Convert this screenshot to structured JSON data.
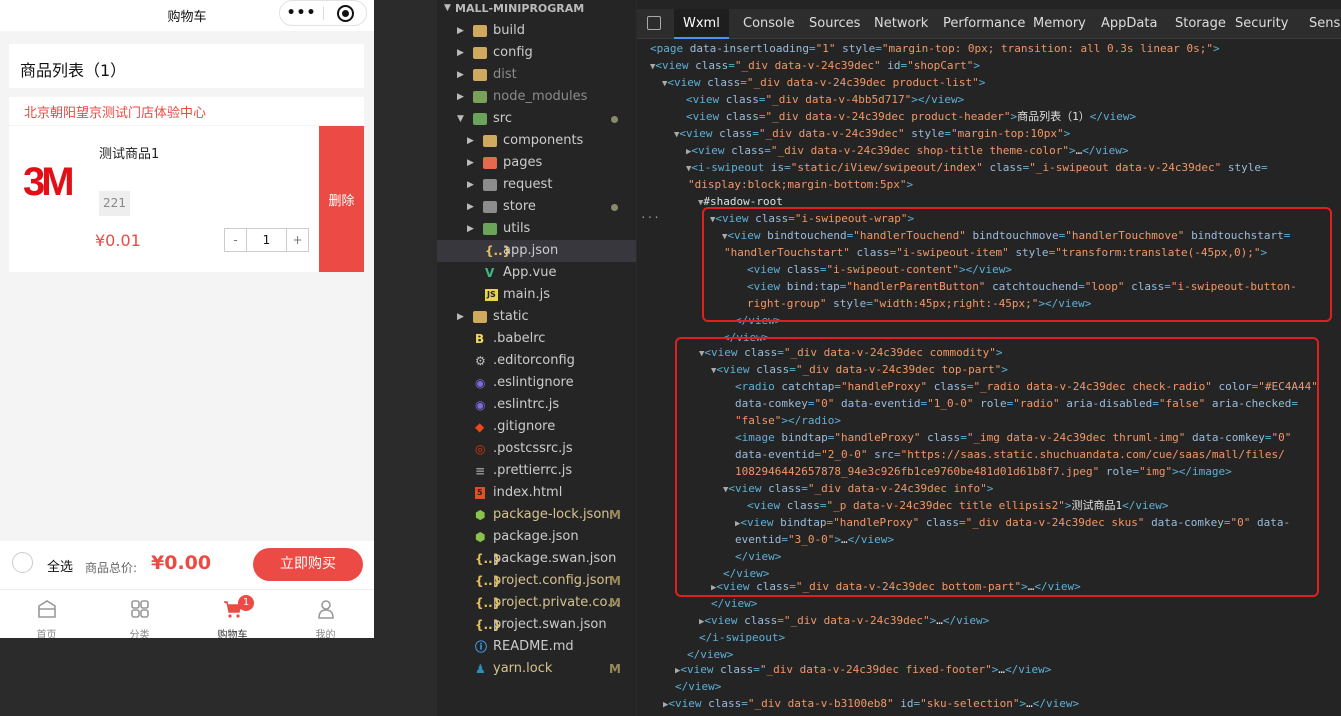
{
  "simulator": {
    "nav_title": "购物车",
    "capsule_dots": "•••",
    "product_header": "商品列表（1）",
    "shop_title": "北京朝阳望京测试门店体验中心",
    "item": {
      "logo": "3M",
      "title": "测试商品1",
      "sku": "221",
      "price": "¥0.01",
      "quantity": "1",
      "minus": "-",
      "plus": "+",
      "delete_label": "删除"
    },
    "footer": {
      "select_all": "全选",
      "total_label": "商品总价:",
      "total_value": "¥0.00",
      "buy_label": "立即购买"
    },
    "tabbar": [
      {
        "label": "首页",
        "icon": "home-icon"
      },
      {
        "label": "分类",
        "icon": "category-icon"
      },
      {
        "label": "购物车",
        "icon": "cart-icon",
        "badge": "1",
        "active": true
      },
      {
        "label": "我的",
        "icon": "user-icon"
      }
    ],
    "accent_color": "#EC4A44"
  },
  "explorer": {
    "root": "MALL-MINIPROGRAM",
    "items": [
      {
        "name": "build",
        "icon": "folder-icon"
      },
      {
        "name": "config",
        "icon": "folder-icon"
      },
      {
        "name": "dist",
        "icon": "folder-icon"
      },
      {
        "name": "node_modules",
        "icon": "folder-icon"
      },
      {
        "name": "src",
        "icon": "folder-icon"
      },
      {
        "name": "components",
        "icon": "folder-icon"
      },
      {
        "name": "pages",
        "icon": "folder-icon"
      },
      {
        "name": "request",
        "icon": "folder-icon"
      },
      {
        "name": "store",
        "icon": "folder-icon"
      },
      {
        "name": "utils",
        "icon": "folder-icon"
      },
      {
        "name": "app.json",
        "icon": "json-icon"
      },
      {
        "name": "App.vue",
        "icon": "vue-icon"
      },
      {
        "name": "main.js",
        "icon": "js-icon"
      },
      {
        "name": "static",
        "icon": "folder-icon"
      },
      {
        "name": ".babelrc",
        "icon": "babel-icon"
      },
      {
        "name": ".editorconfig",
        "icon": "gear-icon"
      },
      {
        "name": ".eslintignore",
        "icon": "eslint-icon"
      },
      {
        "name": ".eslintrc.js",
        "icon": "eslint-icon"
      },
      {
        "name": ".gitignore",
        "icon": "git-icon"
      },
      {
        "name": ".postcssrc.js",
        "icon": "postcss-icon"
      },
      {
        "name": ".prettierrc.js",
        "icon": "prettier-icon"
      },
      {
        "name": "index.html",
        "icon": "html-icon"
      },
      {
        "name": "package-lock.json",
        "icon": "npm-icon",
        "mark": "M"
      },
      {
        "name": "package.json",
        "icon": "npm-icon"
      },
      {
        "name": "package.swan.json",
        "icon": "json-icon"
      },
      {
        "name": "project.config.json",
        "icon": "json-icon",
        "mark": "M"
      },
      {
        "name": "project.private.co...",
        "icon": "json-icon",
        "mark": "M"
      },
      {
        "name": "project.swan.json",
        "icon": "json-icon"
      },
      {
        "name": "README.md",
        "icon": "info-icon"
      },
      {
        "name": "yarn.lock",
        "icon": "yarn-icon",
        "mark": "M"
      }
    ]
  },
  "devtools": {
    "tabs": [
      "Wxml",
      "Console",
      "Sources",
      "Network",
      "Performance",
      "Memory",
      "AppData",
      "Storage",
      "Security",
      "Senso"
    ],
    "active_tab": "Wxml",
    "ellipsis": "···"
  }
}
